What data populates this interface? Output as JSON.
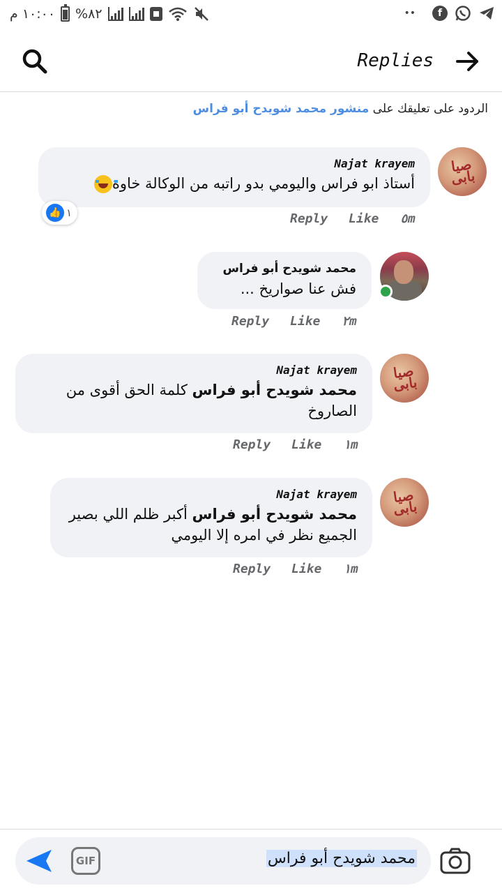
{
  "status_bar": {
    "time": "١٠:٠٠ م",
    "battery": "%٨٢",
    "left_icons": [
      "battery-icon",
      "signal-icon",
      "signal-icon",
      "sim-icon",
      "wifi-icon",
      "mute-icon"
    ],
    "right_icons": [
      "more-dots-icon",
      "facebook-icon",
      "whatsapp-icon",
      "telegram-icon"
    ],
    "more": "••"
  },
  "header": {
    "title": "Replies"
  },
  "context": {
    "prefix": "الردود على تعليقك على ",
    "link": "منشور محمد شويدح أبو فراس"
  },
  "comments": [
    {
      "author": "Najat krayem",
      "text": "أستاذ ابو فراس واليومي بدو راتبه من الوكالة خاوة",
      "has_emoji": true,
      "reaction_count": "١",
      "actions": {
        "reply": "Reply",
        "like": "Like",
        "time": "٥m"
      }
    },
    {
      "author": "محمد شويدح أبو فراس",
      "text": "فش عنا صواريخ ...",
      "online": true,
      "actions": {
        "reply": "Reply",
        "like": "Like",
        "time": "٢m"
      }
    },
    {
      "author": "Najat krayem",
      "mention": "محمد شويدح أبو فراس",
      "text": " كلمة الحق أقوى من الصاروخ",
      "actions": {
        "reply": "Reply",
        "like": "Like",
        "time": "١m"
      }
    },
    {
      "author": "Najat krayem",
      "mention": "محمد شويدح أبو فراس",
      "text": " أكبر ظلم اللي بصير الجميع نظر في امره إلا اليومي",
      "actions": {
        "reply": "Reply",
        "like": "Like",
        "time": "١m"
      }
    }
  ],
  "composer": {
    "value": "محمد شويدح أبو فراس",
    "gif_label": "GIF"
  },
  "colors": {
    "accent": "#1877f2",
    "link": "#4e8de0",
    "bubble": "#f0f2f5",
    "online": "#31a24c"
  }
}
